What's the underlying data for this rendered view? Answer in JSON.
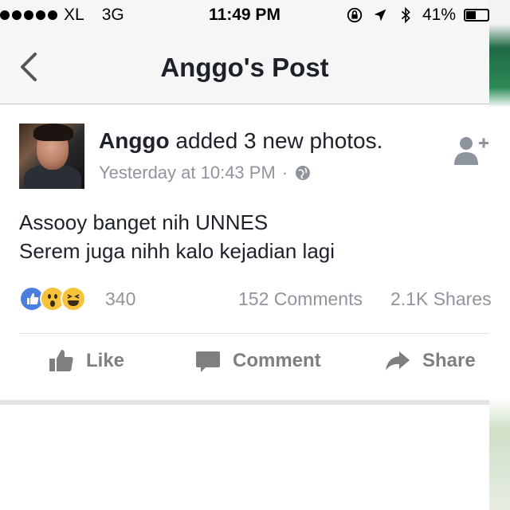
{
  "status_bar": {
    "carrier": "XL",
    "network": "3G",
    "time": "11:49 PM",
    "battery": "41%"
  },
  "nav": {
    "title": "Anggo's Post"
  },
  "post": {
    "author": "Anggo",
    "action": " added 3 new photos.",
    "timestamp": "Yesterday at 10:43 PM",
    "separator": "·",
    "text_line1": "Assooy banget nih UNNES",
    "text_line2": "Serem juga nihh kalo kejadian lagi",
    "reaction_count": "340",
    "comments_count": "152 Comments",
    "shares_count": "2.1K Shares"
  },
  "actions": {
    "like": "Like",
    "comment": "Comment",
    "share": "Share"
  },
  "icons": {
    "reactions": [
      "like-reaction-icon",
      "wow-reaction-icon",
      "haha-reaction-icon"
    ]
  },
  "colors": {
    "like_blue": "#4a7fe0",
    "muted_gray": "#90949c"
  }
}
